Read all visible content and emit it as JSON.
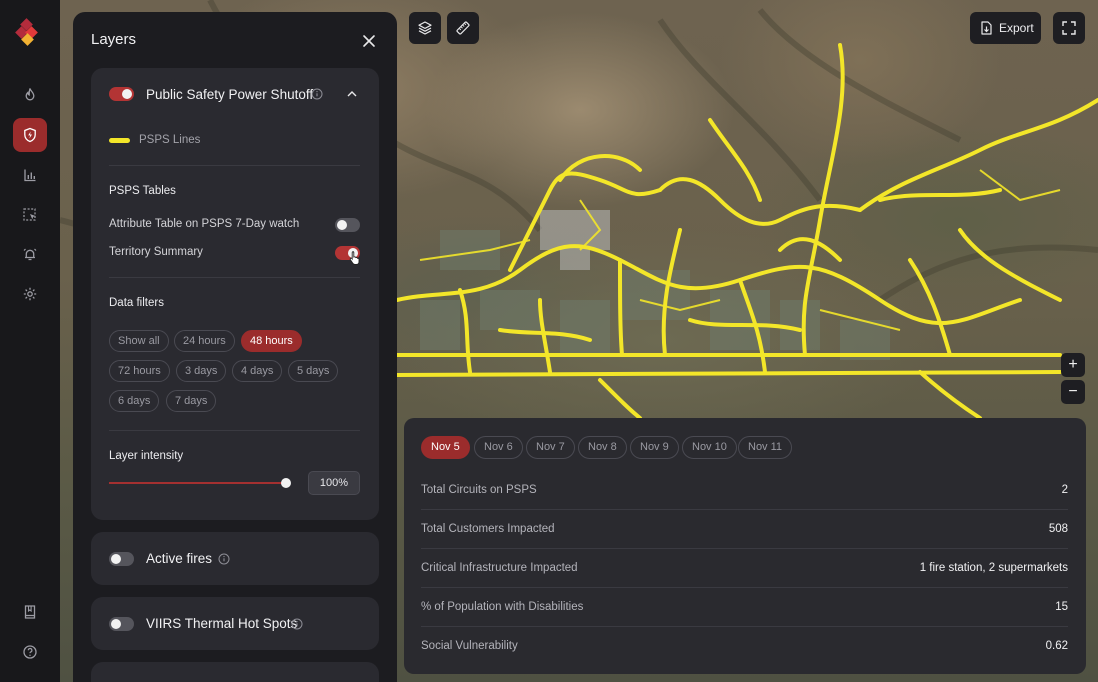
{
  "colors": {
    "accent": "#9b2c2c",
    "toggle_on": "#b33434",
    "psps_line": "#f3e629",
    "panel_bg": "#1c1c20",
    "card_bg": "#2a2a30"
  },
  "nav": {
    "items": [
      {
        "icon": "flame-icon"
      },
      {
        "icon": "shield-bolt-icon",
        "active": true
      },
      {
        "icon": "bar-chart-icon"
      },
      {
        "icon": "select-area-icon"
      },
      {
        "icon": "alarm-bell-icon"
      },
      {
        "icon": "gear-icon"
      }
    ],
    "bottom": [
      {
        "icon": "book-icon"
      },
      {
        "icon": "help-icon"
      }
    ]
  },
  "layers_panel": {
    "title": "Layers",
    "psps": {
      "title": "Public Safety Power Shutoff",
      "enabled": true,
      "legend_label": "PSPS Lines",
      "tables_heading": "PSPS Tables",
      "tables": [
        {
          "label": "Attribute Table on PSPS 7-Day watch",
          "enabled": false
        },
        {
          "label": "Territory Summary",
          "enabled": true
        }
      ],
      "filters_heading": "Data filters",
      "filters": [
        "Show all",
        "24 hours",
        "48 hours",
        "72 hours",
        "3 days",
        "4 days",
        "5 days",
        "6 days",
        "7 days"
      ],
      "selected_filter": "48 hours",
      "intensity_heading": "Layer intensity",
      "intensity_value": "100%",
      "intensity_fraction": 1.0
    },
    "other_layers": [
      {
        "title": "Active fires",
        "enabled": false
      },
      {
        "title": "VIIRS Thermal Hot Spots",
        "enabled": false
      }
    ]
  },
  "map_toolbar": {
    "layers_icon": "layers-icon",
    "measure_icon": "ruler-icon",
    "export_label": "Export",
    "fullscreen_icon": "fullscreen-icon",
    "zoom_in": "+",
    "zoom_out": "−"
  },
  "summary": {
    "dates": [
      "Nov 5",
      "Nov 6",
      "Nov 7",
      "Nov 8",
      "Nov 9",
      "Nov 10",
      "Nov 11"
    ],
    "selected_date": "Nov 5",
    "rows": [
      {
        "label": "Total Circuits on PSPS",
        "value": "2"
      },
      {
        "label": "Total Customers Impacted",
        "value": "508"
      },
      {
        "label": "Critical Infrastructure Impacted",
        "value": "1 fire station, 2 supermarkets"
      },
      {
        "label": "% of Population with Disabilities",
        "value": "15"
      },
      {
        "label": "Social Vulnerability",
        "value": "0.62"
      }
    ]
  }
}
